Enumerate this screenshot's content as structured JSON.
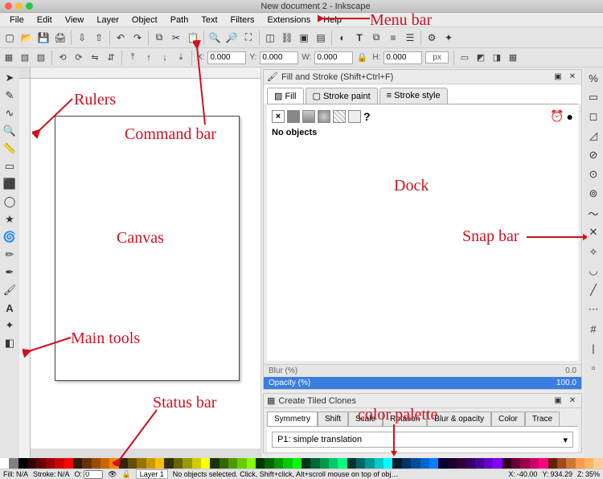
{
  "title": "New document 2 - Inkscape",
  "menu": [
    "File",
    "Edit",
    "View",
    "Layer",
    "Object",
    "Path",
    "Text",
    "Filters",
    "Extensions",
    "Help"
  ],
  "coords": {
    "xlabel": "X:",
    "x": "0.000",
    "ylabel": "Y:",
    "y": "0.000",
    "wlabel": "W:",
    "w": "0.000",
    "hlabel": "H:",
    "h": "0.000",
    "unit": "px"
  },
  "fill_panel": {
    "title": "Fill and Stroke (Shift+Ctrl+F)",
    "tabs": {
      "fill": "Fill",
      "stroke_paint": "Stroke paint",
      "stroke_style": "Stroke style"
    },
    "question": "?",
    "noobj": "No objects",
    "blur_label": "Blur (%)",
    "blur_val": "0.0",
    "opacity_label": "Opacity (%)",
    "opacity_val": "100.0"
  },
  "clone_panel": {
    "title": "Create Tiled Clones",
    "tabs": [
      "Symmetry",
      "Shift",
      "Scale",
      "Rotation",
      "Blur & opacity",
      "Color",
      "Trace"
    ],
    "option": "P1: simple translation"
  },
  "status_bar": {
    "fill": "Fill:",
    "fill_v": "N/A",
    "stroke": "Stroke:",
    "stroke_v": "N/A",
    "o": "O:",
    "o_v": "0",
    "layer": "Layer 1",
    "msg": "No objects selected. Click, Shift+click, Alt+scroll mouse on top of obj…",
    "x": "X:",
    "x_v": "-40.00",
    "y": "Y:",
    "y_v": "934.29",
    "z": "Z:",
    "z_v": "35%"
  },
  "annotations": {
    "menubar": "Menu bar",
    "rulers": "Rulers",
    "commandbar": "Command bar",
    "canvas": "Canvas",
    "dock": "Dock",
    "snapbar": "Snap bar",
    "maintools": "Main tools",
    "statusbar": "Status bar",
    "palette": "color palette"
  },
  "palette_colors": [
    "#ffffff",
    "#808080",
    "#000000",
    "#330000",
    "#660000",
    "#990000",
    "#cc0000",
    "#ff0000",
    "#331a00",
    "#663300",
    "#994d00",
    "#cc6600",
    "#ff8000",
    "#332600",
    "#664d00",
    "#997300",
    "#cc9900",
    "#ffbf00",
    "#333300",
    "#666600",
    "#999900",
    "#cccc00",
    "#ffff00",
    "#1a3300",
    "#336600",
    "#4d9900",
    "#66cc00",
    "#80ff00",
    "#003300",
    "#006600",
    "#009900",
    "#00cc00",
    "#00ff00",
    "#00331a",
    "#006633",
    "#00994d",
    "#00cc66",
    "#00ff80",
    "#003333",
    "#006666",
    "#009999",
    "#00cccc",
    "#00ffff",
    "#001a33",
    "#003366",
    "#004d99",
    "#0066cc",
    "#0080ff",
    "#000033",
    "#1a0033",
    "#330033",
    "#330066",
    "#4d0099",
    "#6600cc",
    "#8000ff",
    "#33001a",
    "#660033",
    "#99004d",
    "#cc0066",
    "#ff0080",
    "#662200",
    "#994d1a",
    "#cc7733",
    "#ff994d",
    "#ffb366",
    "#ffcc99"
  ]
}
